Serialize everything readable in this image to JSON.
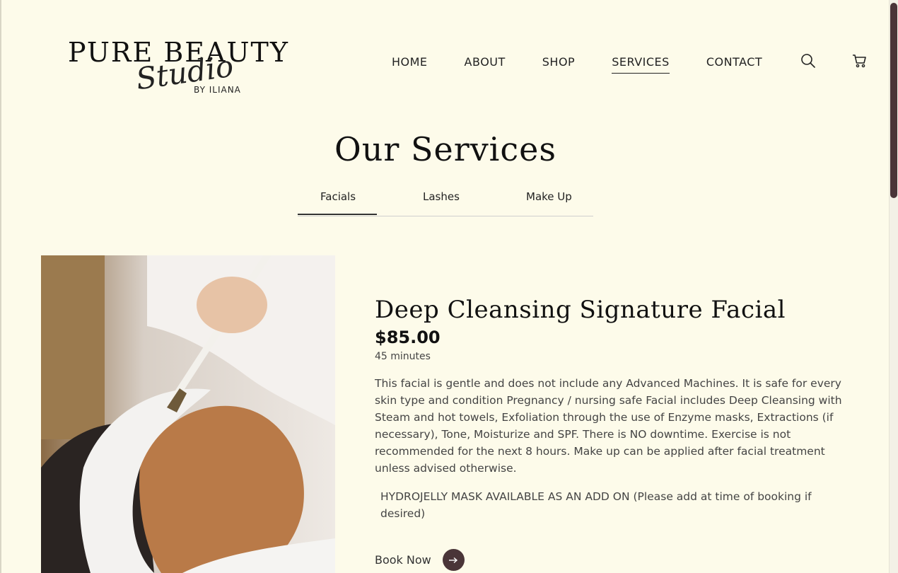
{
  "brand": {
    "main": "PURE BEAUTY",
    "script": "Studio",
    "byline": "BY ILIANA"
  },
  "nav": {
    "items": [
      {
        "label": "HOME"
      },
      {
        "label": "ABOUT"
      },
      {
        "label": "SHOP"
      },
      {
        "label": "SERVICES",
        "active": true
      },
      {
        "label": "CONTACT"
      }
    ],
    "icons": [
      "search-icon",
      "cart-icon"
    ]
  },
  "page": {
    "title": "Our Services"
  },
  "tabs": [
    {
      "label": "Facials",
      "active": true
    },
    {
      "label": "Lashes"
    },
    {
      "label": "Make Up"
    }
  ],
  "service": {
    "title": "Deep Cleansing Signature Facial",
    "price": "$85.00",
    "duration": "45 minutes",
    "description": "This facial is gentle and does not include any Advanced Machines. It is safe for every skin type and condition Pregnancy / nursing safe Facial includes Deep Cleansing with Steam and hot towels, Exfoliation through the use of Enzyme masks, Extractions (if necessary), Tone, Moisturize and SPF. There is NO downtime. Exercise is not recommended for the next 8 hours. Make up can be applied after facial treatment unless advised otherwise.",
    "addon": "HYDROJELLY MASK AVAILABLE AS AN ADD ON (Please add at time of booking if desired)",
    "cta": "Book Now"
  },
  "colors": {
    "background": "#fdfbea",
    "accent": "#4a3538",
    "text": "#222222"
  }
}
